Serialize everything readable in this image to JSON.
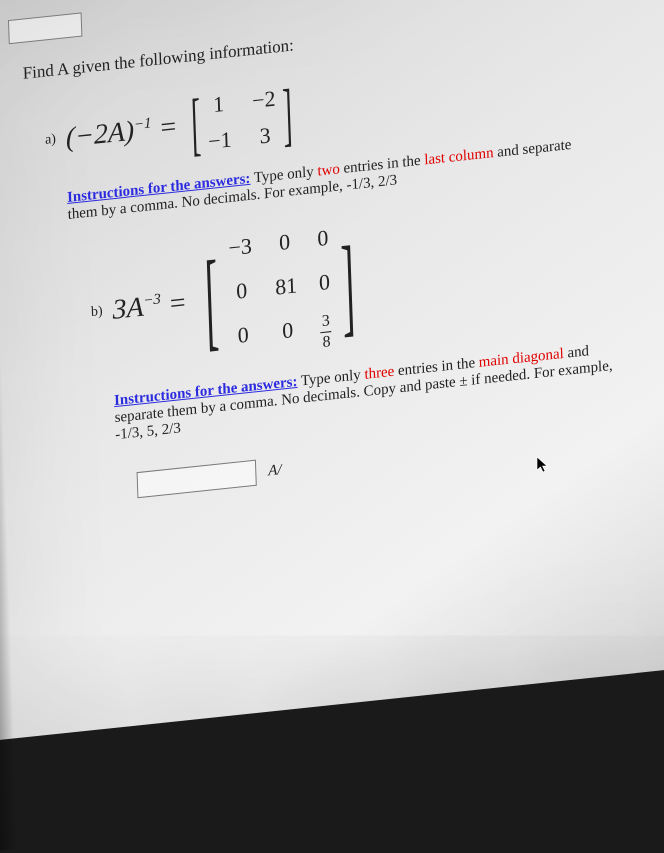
{
  "title": "Find A given the following information:",
  "part_a": {
    "label": "a)",
    "lhs": "(-2A)^{-1} =",
    "matrix": [
      [
        "1",
        "-2"
      ],
      [
        "-1",
        "3"
      ]
    ]
  },
  "instructions_a": {
    "lead": "Instructions for the answers:",
    "body_pre": " Type only ",
    "count_word": "two",
    "body_mid": " entries in the ",
    "target": "last column",
    "body_post": " and separate them by a comma. No decimals. For example, -1/3, 2/3"
  },
  "part_b": {
    "label": "b)",
    "lhs": "3A^{-3} =",
    "matrix": [
      [
        "-3",
        "0",
        "0"
      ],
      [
        "0",
        "81",
        "0"
      ],
      [
        "0",
        "0",
        "3/8"
      ]
    ]
  },
  "instructions_b": {
    "lead": "Instructions for the answers:",
    "body_pre": " Type only ",
    "count_word": "three",
    "body_mid": " entries in the ",
    "target": "main diagonal",
    "body_post": " and separate them by a comma. No decimals. Copy and paste ± if needed. For example, -1/3, 5, 2/3"
  },
  "answer_icon": "A/"
}
